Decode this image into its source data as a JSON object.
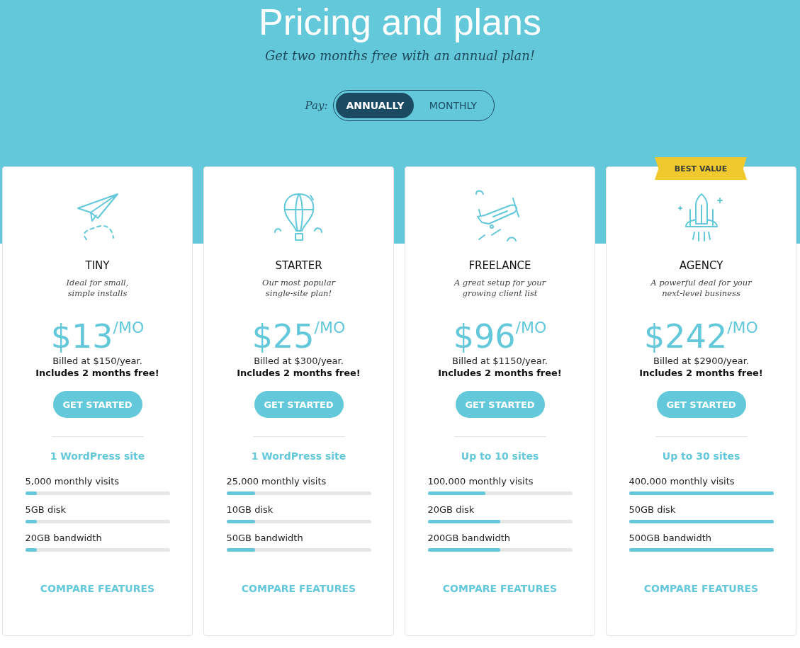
{
  "header": {
    "title": "Pricing and plans",
    "subtitle": "Get two months free with an annual plan!"
  },
  "billing_toggle": {
    "label": "Pay:",
    "options": [
      {
        "label": "ANNUALLY",
        "selected": true
      },
      {
        "label": "MONTHLY",
        "selected": false
      }
    ]
  },
  "plans": [
    {
      "name": "TINY",
      "tagline": [
        "Ideal for small,",
        "simple installs"
      ],
      "price": "$13",
      "unit": "/MO",
      "billed": "Billed at $150/year.",
      "bonus": "Includes 2 months free!",
      "button": "GET STARTED",
      "sites": "1 WordPress site",
      "limits": [
        {
          "label": "5,000 monthly visits",
          "level": 0.08
        },
        {
          "label": "5GB disk",
          "level": 0.08
        },
        {
          "label": "20GB bandwidth",
          "level": 0.08
        }
      ],
      "link": "COMPARE FEATURES"
    },
    {
      "name": "STARTER",
      "tagline": [
        "Our most popular",
        "single-site plan!"
      ],
      "price": "$25",
      "unit": "/MO",
      "billed": "Billed at $300/year.",
      "bonus": "Includes 2 months free!",
      "button": "GET STARTED",
      "sites": "1 WordPress site",
      "limits": [
        {
          "label": "25,000 monthly visits",
          "level": 0.2
        },
        {
          "label": "10GB disk",
          "level": 0.2
        },
        {
          "label": "50GB bandwidth",
          "level": 0.2
        }
      ],
      "link": "COMPARE FEATURES"
    },
    {
      "name": "FREELANCE",
      "tagline": [
        "A great setup for your",
        "growing client list"
      ],
      "price": "$96",
      "unit": "/MO",
      "billed": "Billed at $1150/year.",
      "bonus": "Includes 2 months free!",
      "button": "GET STARTED",
      "sites": "Up to 10 sites",
      "limits": [
        {
          "label": "100,000 monthly visits",
          "level": 0.4
        },
        {
          "label": "20GB disk",
          "level": 0.5
        },
        {
          "label": "200GB bandwidth",
          "level": 0.5
        }
      ],
      "link": "COMPARE FEATURES"
    },
    {
      "name": "AGENCY",
      "badge": "BEST VALUE",
      "tagline": [
        "A powerful deal for your",
        "next-level business"
      ],
      "price": "$242",
      "unit": "/MO",
      "billed": "Billed at $2900/year.",
      "bonus": "Includes 2 months free!",
      "button": "GET STARTED",
      "sites": "Up to 30 sites",
      "limits": [
        {
          "label": "400,000 monthly visits",
          "level": 1
        },
        {
          "label": "50GB disk",
          "level": 1
        },
        {
          "label": "500GB bandwidth",
          "level": 1
        }
      ],
      "link": "COMPARE FEATURES"
    }
  ]
}
